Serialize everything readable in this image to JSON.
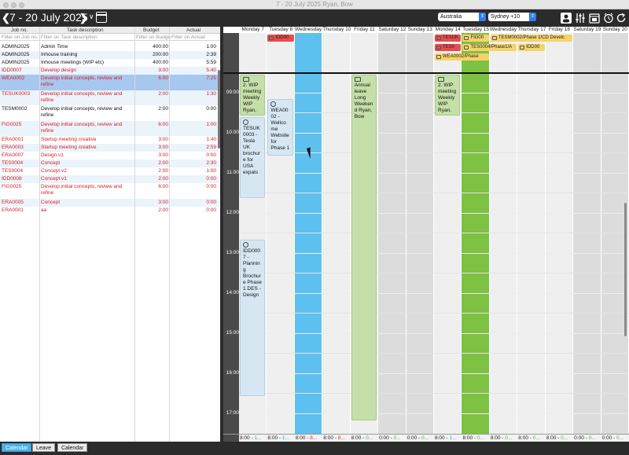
{
  "window": {
    "title": "7 - 20 July 2025  Ryan, Bow"
  },
  "toolbar": {
    "prev_label": "❮",
    "date_range": "7 - 20 July 2025",
    "next_label": "❯",
    "caret": "∨",
    "country": "Australia",
    "timezone": "Sydney +10"
  },
  "left_panel": {
    "headers": {
      "job": "Job no.",
      "task": "Task description",
      "budget": "Budget",
      "actual": "Actual"
    },
    "filters": {
      "job": "Filter on Job no.",
      "task": "Filter on Task description",
      "budget": "Filter on Budge",
      "actual": "Filter on Actual"
    },
    "rows": [
      {
        "job": "ADMIN2025",
        "task": "Admin Time",
        "budget": "400:00",
        "actual": "1:00",
        "color": "#111111",
        "bg": "#ffffff"
      },
      {
        "job": "ADMIN2025",
        "task": "Inhouse training",
        "budget": "200:00",
        "actual": "2:39",
        "color": "#111111",
        "bg": "#ebf3fb"
      },
      {
        "job": "ADMIN2025",
        "task": "Inhouse meetings (WIP etc)",
        "budget": "400:00",
        "actual": "5:59",
        "color": "#111111",
        "bg": "#ffffff"
      },
      {
        "job": "IDD0007",
        "task": "Develop design",
        "budget": "3:00",
        "actual": "5:40",
        "color": "#d82020",
        "bg": "#ebf3fb"
      },
      {
        "job": "WEA0002",
        "task": "Develop initial concepts, review and refine",
        "budget": "6:00",
        "actual": "7:25",
        "color": "#d82020",
        "bg": "#a7c7ef"
      },
      {
        "job": "TESUK0003",
        "task": "Develop initial concepts, review and refine",
        "budget": "2:00",
        "actual": "1:30",
        "color": "#d82020",
        "bg": "#ebf3fb"
      },
      {
        "job": "TESM0002",
        "task": "Develop initial concepts, review and refine",
        "budget": "2:00",
        "actual": "0:00",
        "color": "#111111",
        "bg": "#ffffff"
      },
      {
        "job": "FIG0025",
        "task": "Develop initial concepts, review and refine",
        "budget": "6:00",
        "actual": "1:00",
        "color": "#d82020",
        "bg": "#ebf3fb"
      },
      {
        "job": "ERA0001",
        "task": "Startup meeting creative",
        "budget": "3:00",
        "actual": "1:40",
        "color": "#d82020",
        "bg": "#ffffff"
      },
      {
        "job": "ERA0003",
        "task": "Startup meeting creative",
        "budget": "3:00",
        "actual": "2:59",
        "color": "#d82020",
        "bg": "#ebf3fb"
      },
      {
        "job": "ERA0007",
        "task": "Design v1",
        "budget": "3:00",
        "actual": "0:00",
        "color": "#d82020",
        "bg": "#ffffff"
      },
      {
        "job": "TES0004",
        "task": "Concept",
        "budget": "2:00",
        "actual": "2:30",
        "color": "#d82020",
        "bg": "#ebf3fb"
      },
      {
        "job": "TES0004",
        "task": "Concept v2",
        "budget": "2:00",
        "actual": "1:00",
        "color": "#d82020",
        "bg": "#ffffff"
      },
      {
        "job": "IDD0008",
        "task": "Concept v1",
        "budget": "2:00",
        "actual": "0:00",
        "color": "#d82020",
        "bg": "#ebf3fb"
      },
      {
        "job": "FIG0025",
        "task": "Develop initial concepts, review and refine",
        "budget": "6:00",
        "actual": "0:00",
        "color": "#d82020",
        "bg": "#ffffff"
      },
      {
        "job": "ERA0005",
        "task": "Concept",
        "budget": "3:00",
        "actual": "0:00",
        "color": "#d82020",
        "bg": "#ebf3fb"
      },
      {
        "job": "ERA0001",
        "task": "aa",
        "budget": "2:00",
        "actual": "0:00",
        "color": "#d82020",
        "bg": "#ffffff"
      }
    ]
  },
  "calendar": {
    "days": [
      {
        "label": "Monday 7",
        "bg": "#efefef"
      },
      {
        "label": "Tuesday 8",
        "bg": "#efefef"
      },
      {
        "label": "Wednesday 9",
        "bg": "#5ec0ee"
      },
      {
        "label": "Thursday 10",
        "bg": "#efefef"
      },
      {
        "label": "Friday 11",
        "bg": "#efefef"
      },
      {
        "label": "Saturday 12",
        "bg": "#dcdcdc"
      },
      {
        "label": "Sunday 13",
        "bg": "#dcdcdc"
      },
      {
        "label": "Monday 14",
        "bg": "#efefef"
      },
      {
        "label": "Tuesday 15",
        "bg": "#7dc242"
      },
      {
        "label": "Wednesday 16",
        "bg": "#efefef"
      },
      {
        "label": "Thursday 17",
        "bg": "#efefef"
      },
      {
        "label": "Friday 18",
        "bg": "#efefef"
      },
      {
        "label": "Saturday 19",
        "bg": "#dcdcdc"
      },
      {
        "label": "Sunday 20",
        "bg": "#dcdcdc"
      }
    ],
    "hours": [
      "09:00",
      "10:00",
      "11:00",
      "12:00",
      "13:00",
      "14:00",
      "15:00",
      "16:00",
      "17:00"
    ],
    "allday": [
      {
        "day": 1,
        "row": 0,
        "span": 1,
        "text": "IDD00",
        "bg": "#e84c4c"
      },
      {
        "day": 7,
        "row": 0,
        "span": 1,
        "text": "TESUK",
        "bg": "#e84c4c"
      },
      {
        "day": 8,
        "row": 0,
        "span": 1,
        "text": "FIG00",
        "bg": "#f4d46a"
      },
      {
        "day": 9,
        "row": 0,
        "span": 3,
        "text": "TESM0002/Phase 1/CD Develc",
        "bg": "#f4d46a"
      },
      {
        "day": 7,
        "row": 1,
        "span": 1,
        "text": "TES0",
        "bg": "#e84c4c"
      },
      {
        "day": 8,
        "row": 1,
        "span": 2,
        "text": "TES0004/Phase1/A",
        "bg": "#f4d46a"
      },
      {
        "day": 10,
        "row": 1,
        "span": 1,
        "text": "IDD00",
        "bg": "#f4d46a"
      },
      {
        "day": 7,
        "row": 2,
        "span": 2,
        "text": "WEA0002/Phase ",
        "bg": "#f4d46a"
      }
    ],
    "events": [
      {
        "day": 0,
        "start": -0.05,
        "end": 1.0,
        "text": "2. WIP meeting Weekly WIP Ryan,",
        "bg": "#c5dfa8",
        "icon": "cal"
      },
      {
        "day": 0,
        "start": 1.0,
        "end": 3.05,
        "text": "TESUK 0003 - Tesla UK brochure for USA expats",
        "bg": "#d6e7f3",
        "icon": "clock"
      },
      {
        "day": 1,
        "start": 0.55,
        "end": 2.0,
        "text": "WEA00 02 - Wellco me Website for Phase 1",
        "bg": "#d6e7f3",
        "icon": "clock"
      },
      {
        "day": 0,
        "start": 4.05,
        "end": 8.0,
        "text": "IDD0007 - Planning Brochur e Phase 1 DES - Design",
        "bg": "#d6e7f3",
        "icon": "clock"
      },
      {
        "day": 4,
        "start": -0.05,
        "end": 8.6,
        "text": "Annual leave Long Weeken d Ryan, Bow",
        "bg": "#c5dfa8",
        "icon": "cal"
      },
      {
        "day": 7,
        "start": -0.05,
        "end": 1.0,
        "text": "2. WIP meeting Weekly WIP Ryan,",
        "bg": "#c5dfa8",
        "icon": "cal"
      }
    ],
    "footer": [
      {
        "a": "8:00 - ",
        "b": "1...",
        "cls": "b"
      },
      {
        "a": "8:00 - ",
        "b": "1...",
        "cls": "b"
      },
      {
        "a": "8:00 - ",
        "b": "8...",
        "cls": "r"
      },
      {
        "a": "8:00 - ",
        "b": "8...",
        "cls": "r"
      },
      {
        "a": "8:00 - ",
        "b": "0...",
        "cls": "g"
      },
      {
        "a": "0:00 - ",
        "b": "0...",
        "cls": "g"
      },
      {
        "a": "0:00 - ",
        "b": "0...",
        "cls": "g"
      },
      {
        "a": "8:00 - ",
        "b": "1...",
        "cls": "b"
      },
      {
        "a": "8:00 - ",
        "b": "0...",
        "cls": "g"
      },
      {
        "a": "8:00 - ",
        "b": "0...",
        "cls": "g"
      },
      {
        "a": "8:00 - ",
        "b": "0...",
        "cls": "g"
      },
      {
        "a": "8:00 - ",
        "b": "0...",
        "cls": "g"
      },
      {
        "a": "0:00 - ",
        "b": "0...",
        "cls": "g"
      },
      {
        "a": "0:00 - ",
        "b": "0...",
        "cls": "g"
      }
    ]
  },
  "tabs": [
    {
      "label": "Calendar",
      "active": true
    },
    {
      "label": "Leave",
      "active": false
    },
    {
      "label": "Calendar",
      "active": false
    }
  ]
}
